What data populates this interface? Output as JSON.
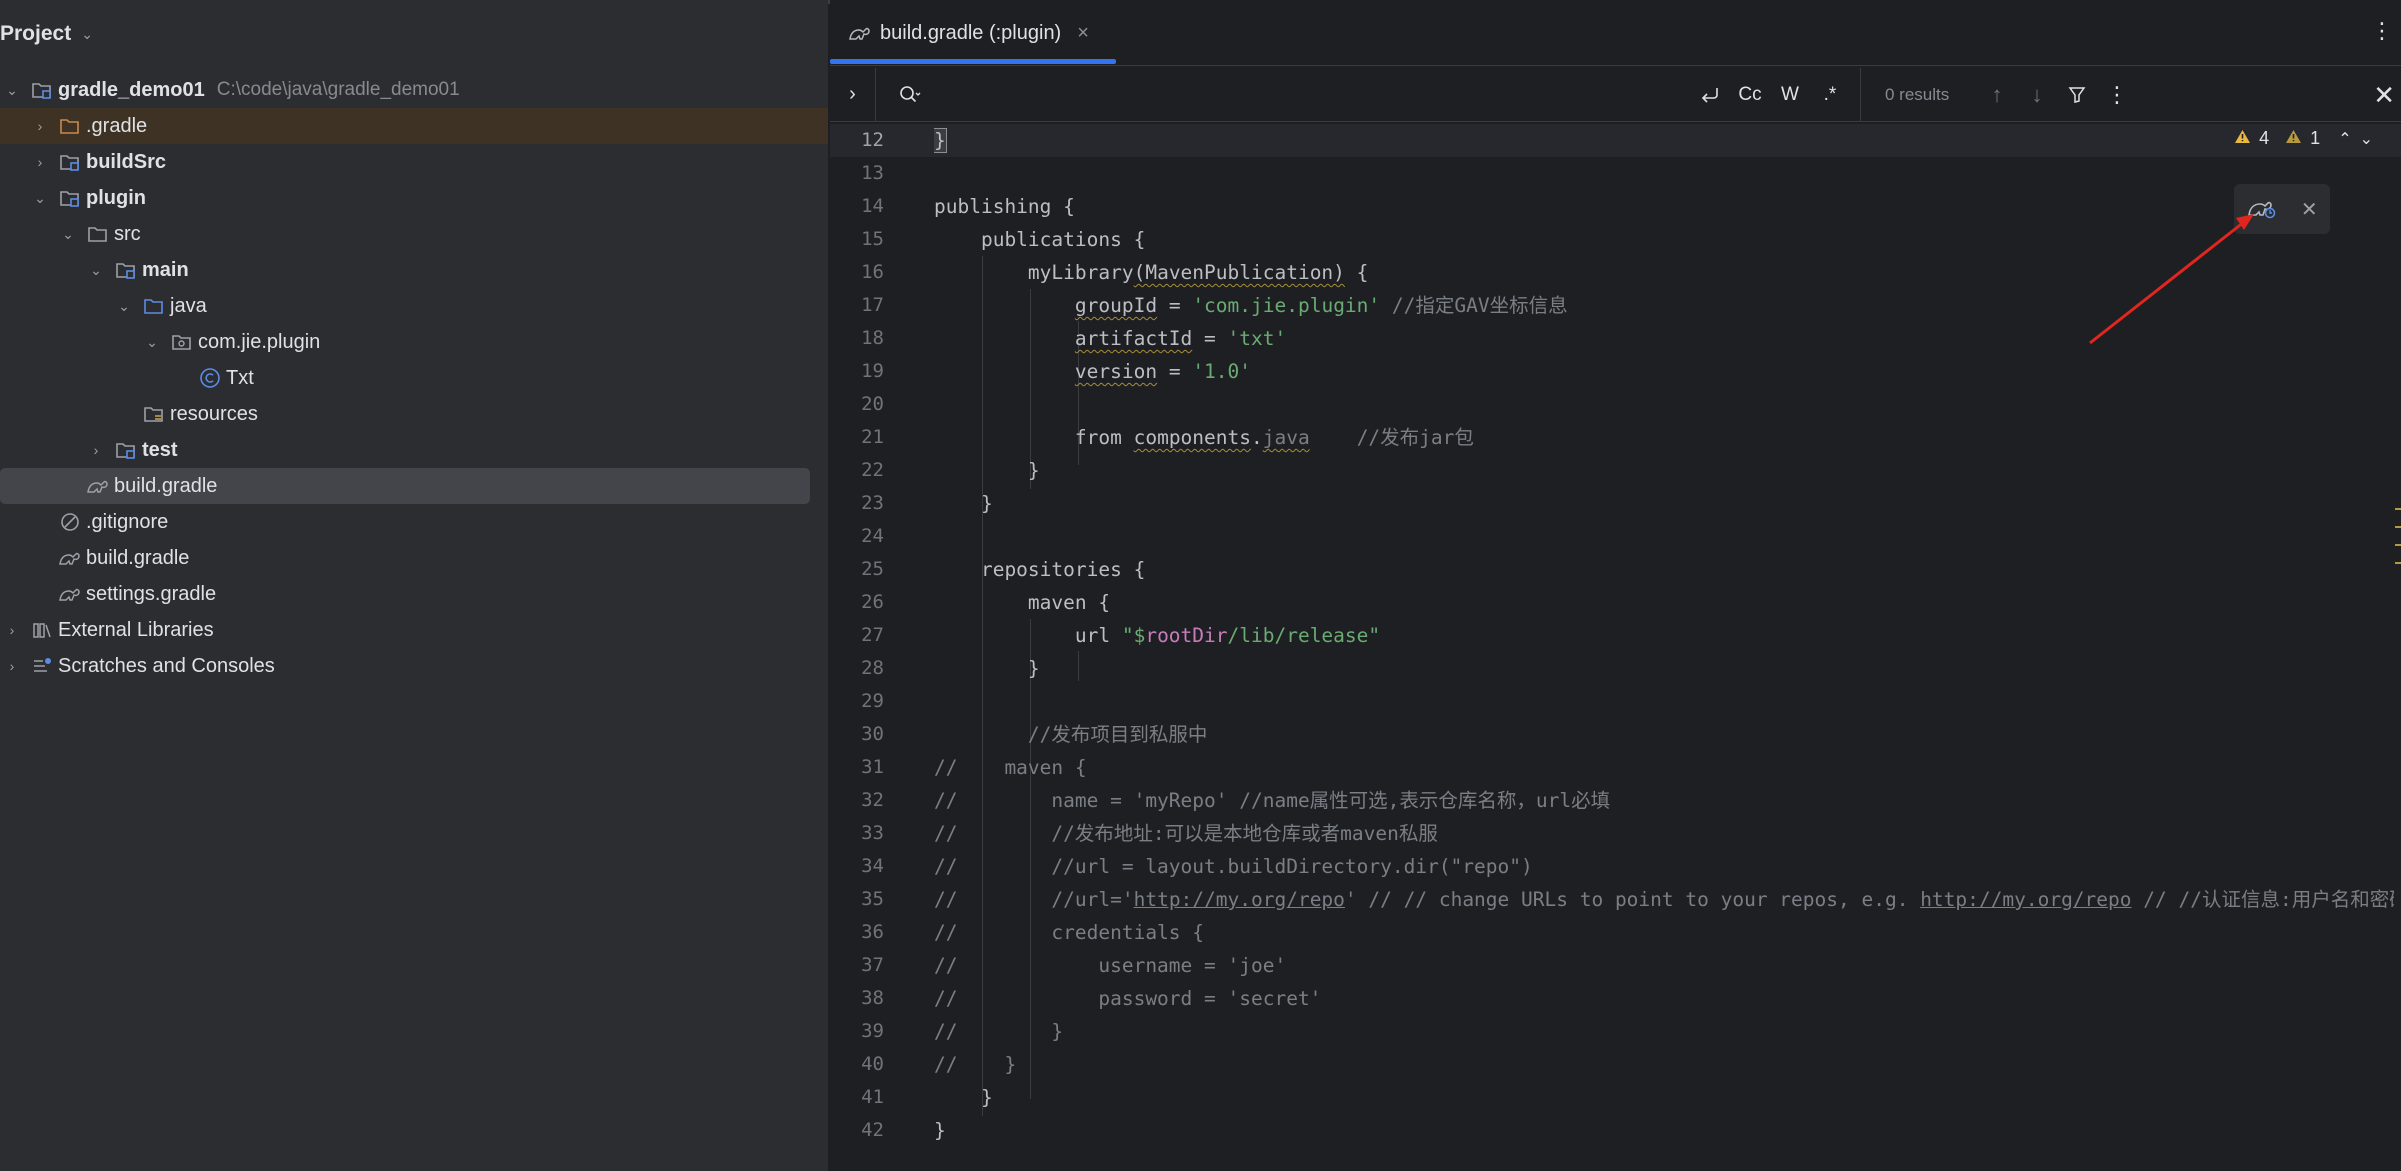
{
  "project_panel": {
    "title": "Project",
    "tree": [
      {
        "label": "gradle_demo01",
        "path": "C:\\code\\java\\gradle_demo01",
        "bold": true
      },
      {
        "label": ".gradle"
      },
      {
        "label": "buildSrc",
        "bold": true
      },
      {
        "label": "plugin",
        "bold": true
      },
      {
        "label": "src"
      },
      {
        "label": "main",
        "bold": true
      },
      {
        "label": "java"
      },
      {
        "label": "com.jie.plugin"
      },
      {
        "label": "Txt"
      },
      {
        "label": "resources"
      },
      {
        "label": "test",
        "bold": true
      },
      {
        "label": "build.gradle",
        "selected": true
      },
      {
        "label": ".gitignore"
      },
      {
        "label": "build.gradle"
      },
      {
        "label": "settings.gradle"
      },
      {
        "label": "External Libraries"
      },
      {
        "label": "Scratches and Consoles"
      }
    ]
  },
  "editor": {
    "tab": {
      "label": "build.gradle (:plugin)",
      "close": "×"
    },
    "find": {
      "placeholder": "",
      "results": "0 results",
      "options": [
        "Cc",
        "W",
        ".*"
      ]
    },
    "inspections": {
      "warnings": "4",
      "weak_warnings": "1"
    },
    "line_numbers": [
      "12",
      "13",
      "14",
      "15",
      "16",
      "17",
      "18",
      "19",
      "20",
      "21",
      "22",
      "23",
      "24",
      "25",
      "26",
      "27",
      "28",
      "29",
      "30",
      "31",
      "32",
      "33",
      "34",
      "35",
      "36",
      "37",
      "38",
      "39",
      "40",
      "41",
      "42"
    ],
    "code_lines": [
      "}",
      "",
      "publishing {",
      "    publications {",
      "        myLibrary(MavenPublication) {",
      "            groupId = 'com.jie.plugin' //指定GAV坐标信息",
      "            artifactId = 'txt'",
      "            version = '1.0'",
      "",
      "            from components.java    //发布jar包",
      "        }",
      "    }",
      "",
      "    repositories {",
      "        maven {",
      "            url \"$rootDir/lib/release\"",
      "        }",
      "",
      "        //发布项目到私服中",
      "//    maven {",
      "//        name = 'myRepo' //name属性可选,表示仓库名称，url必填",
      "//        //发布地址:可以是本地仓库或者maven私服",
      "//        //url = layout.buildDirectory.dir(\"repo\")",
      "//        //url='http://my.org/repo' // // change URLs to point to your repos, e.g. http://my.org/repo // //认证信息:用户名和密码",
      "//        credentials {",
      "//            username = 'joe'",
      "//            password = 'secret'",
      "//        }",
      "//    }",
      "    }",
      "}"
    ]
  },
  "colors": {
    "accent": "#3574f0",
    "string": "#6aab73",
    "comment": "#7a7e85",
    "interpolation": "#c77dbb",
    "warning": "#e8b93c",
    "annotation_arrow": "#e0261f"
  }
}
